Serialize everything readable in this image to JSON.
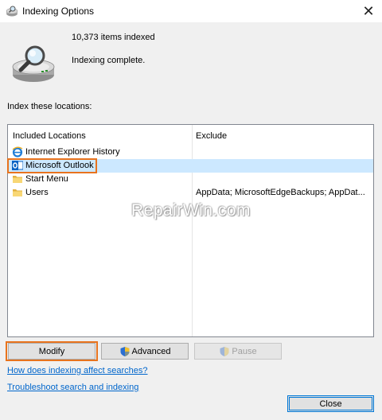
{
  "window": {
    "title": "Indexing Options",
    "close_glyph": "✕"
  },
  "status": {
    "items_indexed": "10,373 items indexed",
    "message": "Indexing complete."
  },
  "locations": {
    "label": "Index these locations:",
    "columns": {
      "included": "Included Locations",
      "exclude": "Exclude"
    },
    "rows": [
      {
        "label": "Internet Explorer History",
        "exclude": "",
        "icon": "ie-icon",
        "selected": false
      },
      {
        "label": "Microsoft Outlook",
        "exclude": "",
        "icon": "outlook-icon",
        "selected": true
      },
      {
        "label": "Start Menu",
        "exclude": "",
        "icon": "folder-icon",
        "selected": false
      },
      {
        "label": "Users",
        "exclude": "AppData; MicrosoftEdgeBackups; AppDat...",
        "icon": "folder-icon",
        "selected": false
      }
    ]
  },
  "watermark": "RepairWin.com",
  "buttons": {
    "modify": "Modify",
    "advanced": "Advanced",
    "pause": "Pause",
    "close": "Close"
  },
  "links": {
    "how_indexing": "How does indexing affect searches?",
    "troubleshoot": "Troubleshoot search and indexing"
  },
  "colors": {
    "highlight": "#e8731d",
    "selection": "#cce8ff",
    "link": "#0066cc",
    "focus_border": "#0078d7"
  }
}
